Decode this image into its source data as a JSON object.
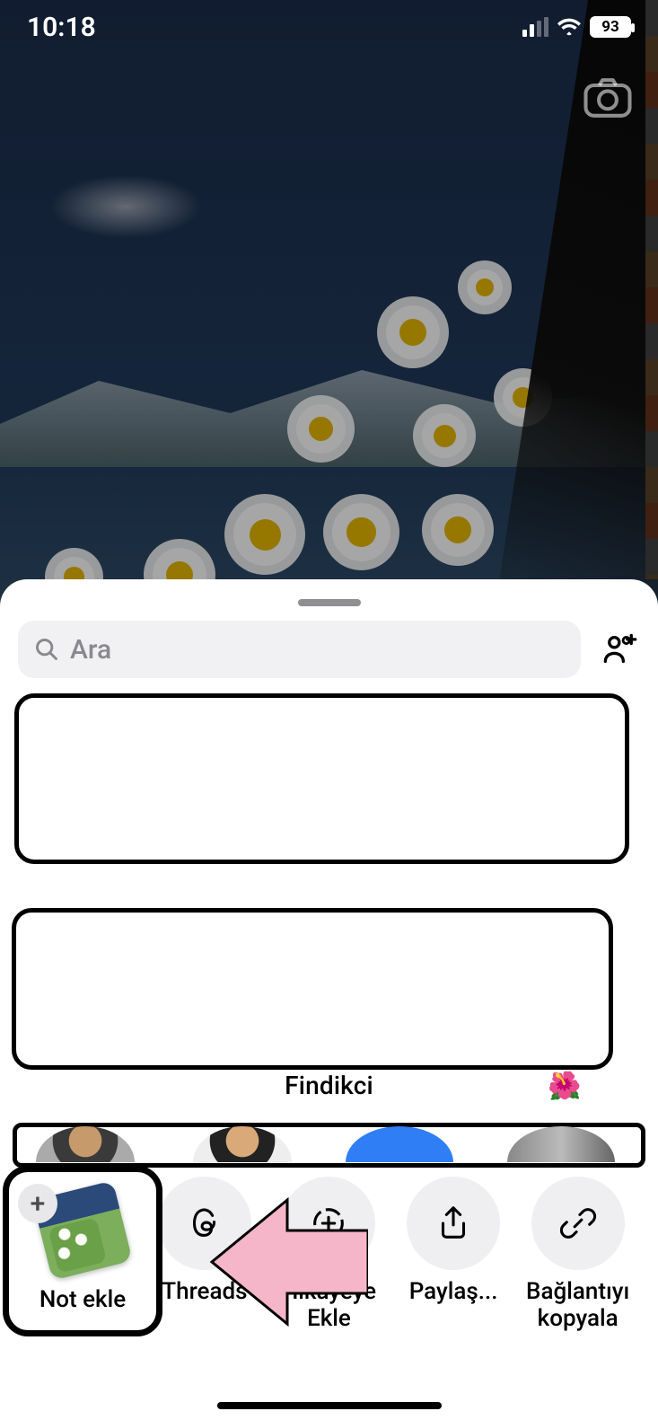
{
  "status": {
    "time": "10:18",
    "battery": "93"
  },
  "sheet": {
    "search_placeholder": "Ara",
    "row_label": "Findikci",
    "hibiscus": "🌺"
  },
  "actions": {
    "not_ekle": "Not ekle",
    "threads": "Threads",
    "hikayeye": "Hikayeye\nEkle",
    "paylas": "Paylaş...",
    "baglanti": "Bağlantıyı\nkopyala"
  }
}
